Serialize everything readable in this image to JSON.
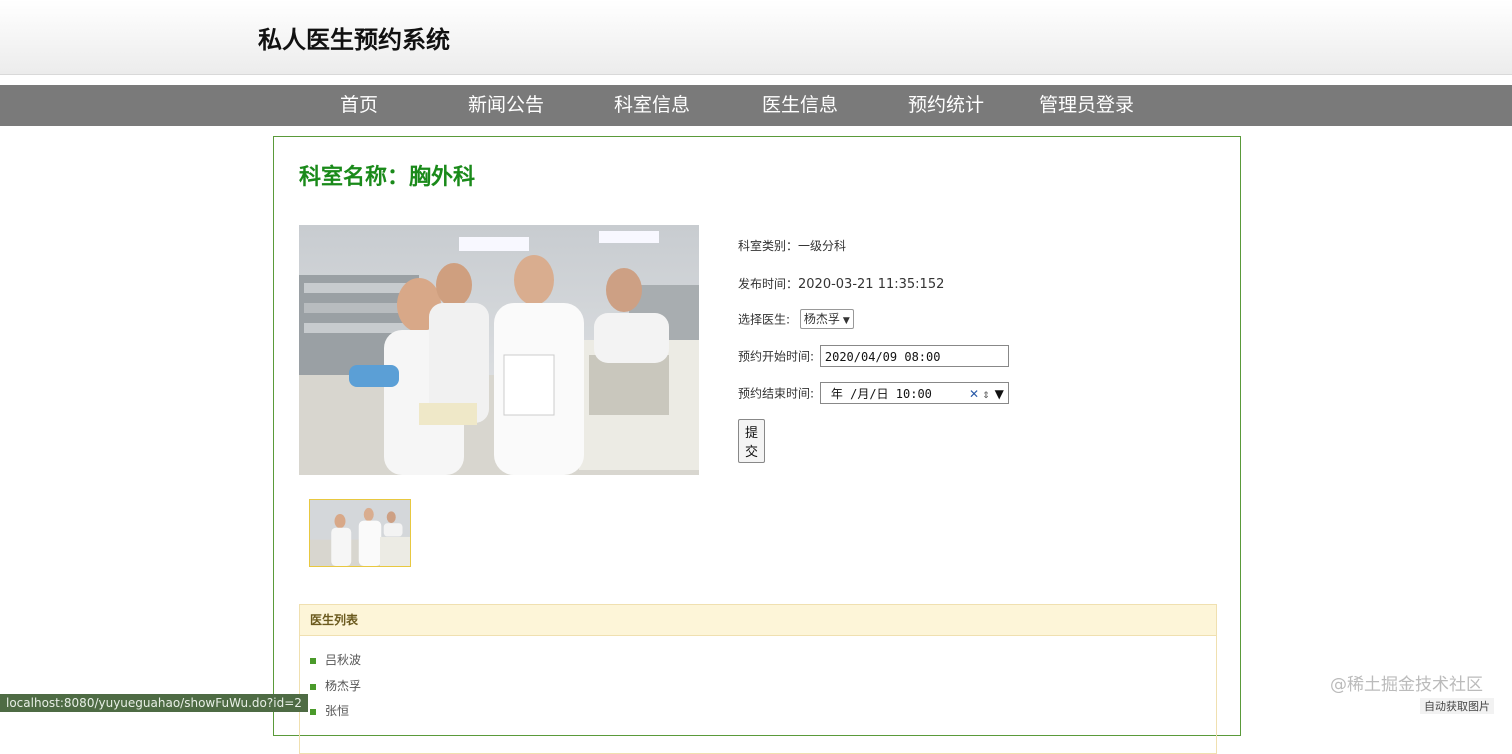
{
  "site": {
    "title": "私人医生预约系统"
  },
  "nav": {
    "items": [
      {
        "label": "首页"
      },
      {
        "label": "新闻公告"
      },
      {
        "label": "科室信息"
      },
      {
        "label": "医生信息"
      },
      {
        "label": "预约统计"
      },
      {
        "label": "管理员登录"
      }
    ]
  },
  "dept": {
    "title": "科室名称：胸外科",
    "category_label": "科室类别：",
    "category_value": "一级分科",
    "publish_label": "发布时间：",
    "publish_value": "2020-03-21 11:35:152"
  },
  "form": {
    "doctor_label": "选择医生:",
    "doctor_selected": "杨杰孚",
    "start_label": "预约开始时间:",
    "start_value": "2020/04/09 08:00",
    "end_label": "预约结束时间:",
    "end_value": "年 /月/日 10:00",
    "submit_label": "提交"
  },
  "doctor_list": {
    "title": "医生列表",
    "items": [
      "吕秋波",
      "杨杰孚",
      "张恒"
    ]
  },
  "status_bar": {
    "url": "localhost:8080/yuyueguahao/showFuWu.do?id=2"
  },
  "watermark": {
    "text": "@稀土掘金技术社区"
  },
  "corner": {
    "text": "自动获取图片"
  },
  "colors": {
    "nav_bg": "#7a7a7a",
    "title_green": "#1a8a1a",
    "panel_head_bg": "#fdf5d8",
    "bullet_green": "#4a9a2a"
  }
}
